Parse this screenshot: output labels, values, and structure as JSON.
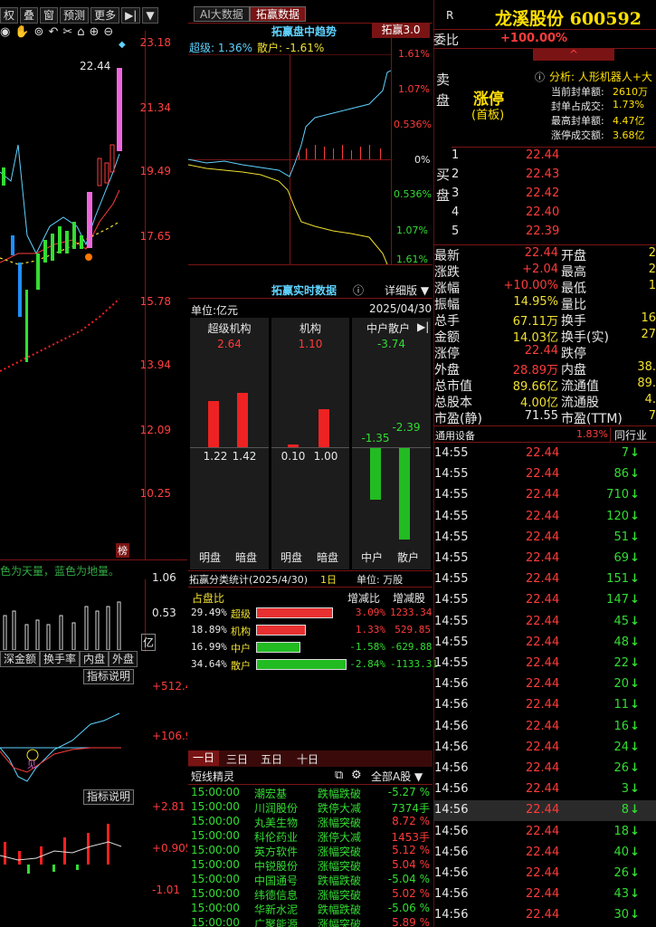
{
  "left": {
    "toolbar": [
      "权",
      "叠",
      "窗",
      "预测",
      "更多",
      "▶|",
      "▼"
    ],
    "price_axis": [
      "23.18",
      "21.34",
      "19.49",
      "17.65",
      "15.78",
      "13.94",
      "12.09",
      "10.25"
    ],
    "peak_label": "22.44",
    "rank_badge": "榜",
    "vol_hint": "色为天量，蓝色为地量。",
    "vol_axis": [
      "1.06",
      "0.53",
      "亿"
    ],
    "subtabs": [
      "深金额",
      "换手率",
      "内盘",
      "外盘"
    ],
    "ind_desc_1": "指标说明",
    "ind_axis_1": [
      "+512.4",
      "+106.9"
    ],
    "ind_desc_2": "指标说明",
    "ind_axis_2": [
      "+2.81",
      "+0.905",
      "-1.01"
    ]
  },
  "mid": {
    "tab_ai": "AI大数据",
    "tab_tuoying": "拓赢数据",
    "trend_title": "拓赢盘中趋势",
    "trend_badge": "拓赢3.0",
    "super_label": "超级: 1.36%",
    "retail_label": "散户: -1.61%",
    "trend_axis": [
      "1.61%",
      "1.07%",
      "0.536%",
      "0%",
      "0.536%",
      "1.07%",
      "1.61%"
    ],
    "realtime_title": "拓赢实时数据",
    "detail_btn": "详细版",
    "unit": "单位:亿元",
    "date": "2025/04/30",
    "groups": [
      {
        "name": "超级机构",
        "total": "2.64",
        "v1": "1.22",
        "v2": "1.42",
        "l1": "明盘",
        "l2": "暗盘"
      },
      {
        "name": "机构",
        "total": "1.10",
        "v1": "0.10",
        "v2": "1.00",
        "l1": "明盘",
        "l2": "暗盘"
      },
      {
        "name": "中户散户",
        "total": "-3.74",
        "v1": "-1.35",
        "v2": "-2.39",
        "l1": "中户",
        "l2": "散户"
      }
    ],
    "group3_btn": "▶|",
    "stats_title": "拓赢分类统计(2025/4/30)",
    "stats_period": "1日",
    "stats_unit": "单位: 万股",
    "stats_header": [
      "占盘比",
      "增减比",
      "增减股"
    ],
    "stats": [
      {
        "pct": "29.49%",
        "name": "超级",
        "ratio": 0.2949,
        "color": "#e83030",
        "d1": "3.09%",
        "d2": "1233.34"
      },
      {
        "pct": "18.89%",
        "name": "机构",
        "ratio": 0.1889,
        "color": "#e83030",
        "d1": "1.33%",
        "d2": "529.85"
      },
      {
        "pct": "16.99%",
        "name": "中户",
        "ratio": 0.1699,
        "color": "#22bb22",
        "d1": "-1.58%",
        "d2": "-629.88"
      },
      {
        "pct": "34.64%",
        "name": "散户",
        "ratio": 0.3464,
        "color": "#22bb22",
        "d1": "-2.84%",
        "d2": "-1133.31"
      }
    ],
    "period_tabs": [
      "一日",
      "三日",
      "五日",
      "十日"
    ],
    "ls_title": "短线精灵",
    "ls_filter": "全部A股",
    "ls_rows": [
      {
        "time": "15:00:00",
        "name": "潮宏基",
        "event": "跌幅跌破",
        "val": "-5.27 %",
        "up": false
      },
      {
        "time": "15:00:00",
        "name": "川润股份",
        "event": "跌停大减",
        "val": "7374手",
        "up": false
      },
      {
        "time": "15:00:00",
        "name": "丸美生物",
        "event": "涨幅突破",
        "val": "8.72 %",
        "up": true
      },
      {
        "time": "15:00:00",
        "name": "科伦药业",
        "event": "涨停大减",
        "val": "1453手",
        "up": true
      },
      {
        "time": "15:00:00",
        "name": "英方软件",
        "event": "涨幅突破",
        "val": "5.12 %",
        "up": true
      },
      {
        "time": "15:00:00",
        "name": "中锐股份",
        "event": "涨幅突破",
        "val": "5.04 %",
        "up": true
      },
      {
        "time": "15:00:00",
        "name": "中国通号",
        "event": "跌幅跌破",
        "val": "-5.04 %",
        "up": false
      },
      {
        "time": "15:00:00",
        "name": "纬德信息",
        "event": "涨幅突破",
        "val": "5.02 %",
        "up": true
      },
      {
        "time": "15:00:00",
        "name": "华新水泥",
        "event": "跌幅跌破",
        "val": "-5.06 %",
        "up": false
      },
      {
        "time": "15:00:00",
        "name": "广聚能源",
        "event": "涨幅突破",
        "val": "5.89 %",
        "up": true
      }
    ]
  },
  "right": {
    "badge": "R",
    "title": "龙溪股份 600592",
    "weibi_label": "委比",
    "weibi_value": "+100.00%",
    "sell_label": "卖盘",
    "limit_text": "涨停",
    "limit_sub": "(首板)",
    "analysis": "分析: 人形机器人+大",
    "seal_info": [
      {
        "k": "当前封单额:",
        "v": "2610万"
      },
      {
        "k": "封单占成交:",
        "v": "1.73%"
      },
      {
        "k": "最高封单额:",
        "v": "4.47亿"
      },
      {
        "k": "涨停成交额:",
        "v": "3.68亿"
      }
    ],
    "buy_label": "买盘",
    "bids": [
      {
        "lv": "1",
        "price": "22.44"
      },
      {
        "lv": "2",
        "price": "22.43"
      },
      {
        "lv": "3",
        "price": "22.42"
      },
      {
        "lv": "4",
        "price": "22.40"
      },
      {
        "lv": "5",
        "price": "22.39"
      }
    ],
    "quote": [
      {
        "k1": "最新",
        "v1": "22.44",
        "c1": "red",
        "k2": "开盘",
        "v2": "2"
      },
      {
        "k1": "涨跌",
        "v1": "+2.04",
        "c1": "red",
        "k2": "最高",
        "v2": "2"
      },
      {
        "k1": "涨幅",
        "v1": "+10.00%",
        "c1": "red",
        "k2": "最低",
        "v2": "1"
      },
      {
        "k1": "振幅",
        "v1": "14.95%",
        "c1": "yellow",
        "k2": "量比",
        "v2": ""
      },
      {
        "k1": "总手",
        "v1": "67.11万",
        "c1": "yellow",
        "k2": "换手",
        "v2": "16"
      },
      {
        "k1": "金额",
        "v1": "14.03亿",
        "c1": "yellow",
        "k2": "换手(实)",
        "v2": "27"
      },
      {
        "k1": "涨停",
        "v1": "22.44",
        "c1": "red",
        "k2": "跌停",
        "v2": ""
      },
      {
        "k1": "外盘",
        "v1": "28.89万",
        "c1": "red",
        "k2": "内盘",
        "v2": "38."
      },
      {
        "k1": "总市值",
        "v1": "89.66亿",
        "c1": "yellow",
        "k2": "流通值",
        "v2": "89."
      },
      {
        "k1": "总股本",
        "v1": "4.00亿",
        "c1": "yellow",
        "k2": "流通股",
        "v2": "4."
      },
      {
        "k1": "市盈(静)",
        "v1": "71.55",
        "c1": "white",
        "k2": "市盈(TTM)",
        "v2": "7"
      }
    ],
    "sector": "通用设备",
    "sector_pct": "1.83%",
    "sector_btn": "同行业",
    "ticks": [
      {
        "t": "14:55",
        "p": "22.44",
        "v": "7"
      },
      {
        "t": "14:55",
        "p": "22.44",
        "v": "86"
      },
      {
        "t": "14:55",
        "p": "22.44",
        "v": "710"
      },
      {
        "t": "14:55",
        "p": "22.44",
        "v": "120"
      },
      {
        "t": "14:55",
        "p": "22.44",
        "v": "51"
      },
      {
        "t": "14:55",
        "p": "22.44",
        "v": "69"
      },
      {
        "t": "14:55",
        "p": "22.44",
        "v": "151"
      },
      {
        "t": "14:55",
        "p": "22.44",
        "v": "147"
      },
      {
        "t": "14:55",
        "p": "22.44",
        "v": "45"
      },
      {
        "t": "14:55",
        "p": "22.44",
        "v": "48"
      },
      {
        "t": "14:55",
        "p": "22.44",
        "v": "22"
      },
      {
        "t": "14:56",
        "p": "22.44",
        "v": "20"
      },
      {
        "t": "14:56",
        "p": "22.44",
        "v": "11"
      },
      {
        "t": "14:56",
        "p": "22.44",
        "v": "16"
      },
      {
        "t": "14:56",
        "p": "22.44",
        "v": "24"
      },
      {
        "t": "14:56",
        "p": "22.44",
        "v": "26"
      },
      {
        "t": "14:56",
        "p": "22.44",
        "v": "3"
      },
      {
        "t": "14:56",
        "p": "22.44",
        "v": "8"
      },
      {
        "t": "14:56",
        "p": "22.44",
        "v": "18"
      },
      {
        "t": "14:56",
        "p": "22.44",
        "v": "40"
      },
      {
        "t": "14:56",
        "p": "22.44",
        "v": "26"
      },
      {
        "t": "14:56",
        "p": "22.44",
        "v": "43"
      },
      {
        "t": "14:56",
        "p": "22.44",
        "v": "30"
      }
    ]
  }
}
